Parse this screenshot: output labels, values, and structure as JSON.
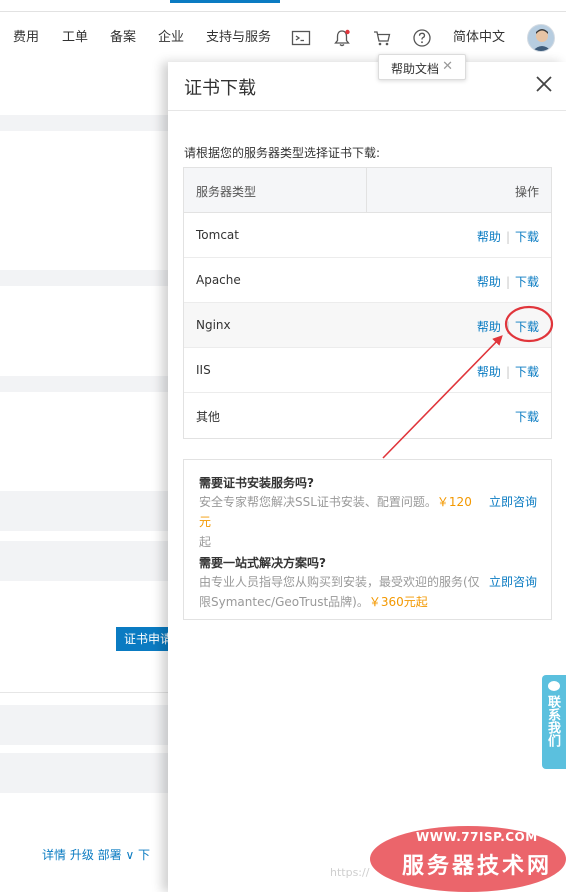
{
  "nav": {
    "items": [
      "费用",
      "工单",
      "备案",
      "企业",
      "支持与服务"
    ],
    "language": "简体中文"
  },
  "background": {
    "apply_button": "证书申请",
    "links": "详情 升级 部署 ∨ 下"
  },
  "help_tooltip": {
    "label": "帮助文档"
  },
  "drawer": {
    "title": "证书下载",
    "instruction": "请根据您的服务器类型选择证书下载:",
    "table": {
      "col_type": "服务器类型",
      "col_op": "操作",
      "help_label": "帮助",
      "download_label": "下载",
      "rows": [
        {
          "server": "Tomcat"
        },
        {
          "server": "Apache"
        },
        {
          "server": "Nginx"
        },
        {
          "server": "IIS"
        },
        {
          "server": "其他"
        }
      ]
    },
    "promo": [
      {
        "title": "需要证书安装服务吗?",
        "desc": "安全专家帮您解决SSL证书安装、配置问题。",
        "price": "￥120元",
        "desc_tail": "起",
        "action": "立即咨询"
      },
      {
        "title": "需要一站式解决方案吗?",
        "desc": "由专业人员指导您从购买到安装，最受欢迎的服务(仅限Symantec/GeoTrust品牌)。",
        "price": "￥360元起",
        "action": "立即咨询"
      }
    ]
  },
  "contact_tab": {
    "label": "联系我们"
  },
  "watermark": {
    "url": "WWW.77ISP.COM",
    "name": "服务器技术网",
    "faint": "https://"
  },
  "colors": {
    "link": "#0a7bc2",
    "price": "#f39800",
    "annotation": "#e0353b",
    "contact_tab": "#5bc0de"
  }
}
